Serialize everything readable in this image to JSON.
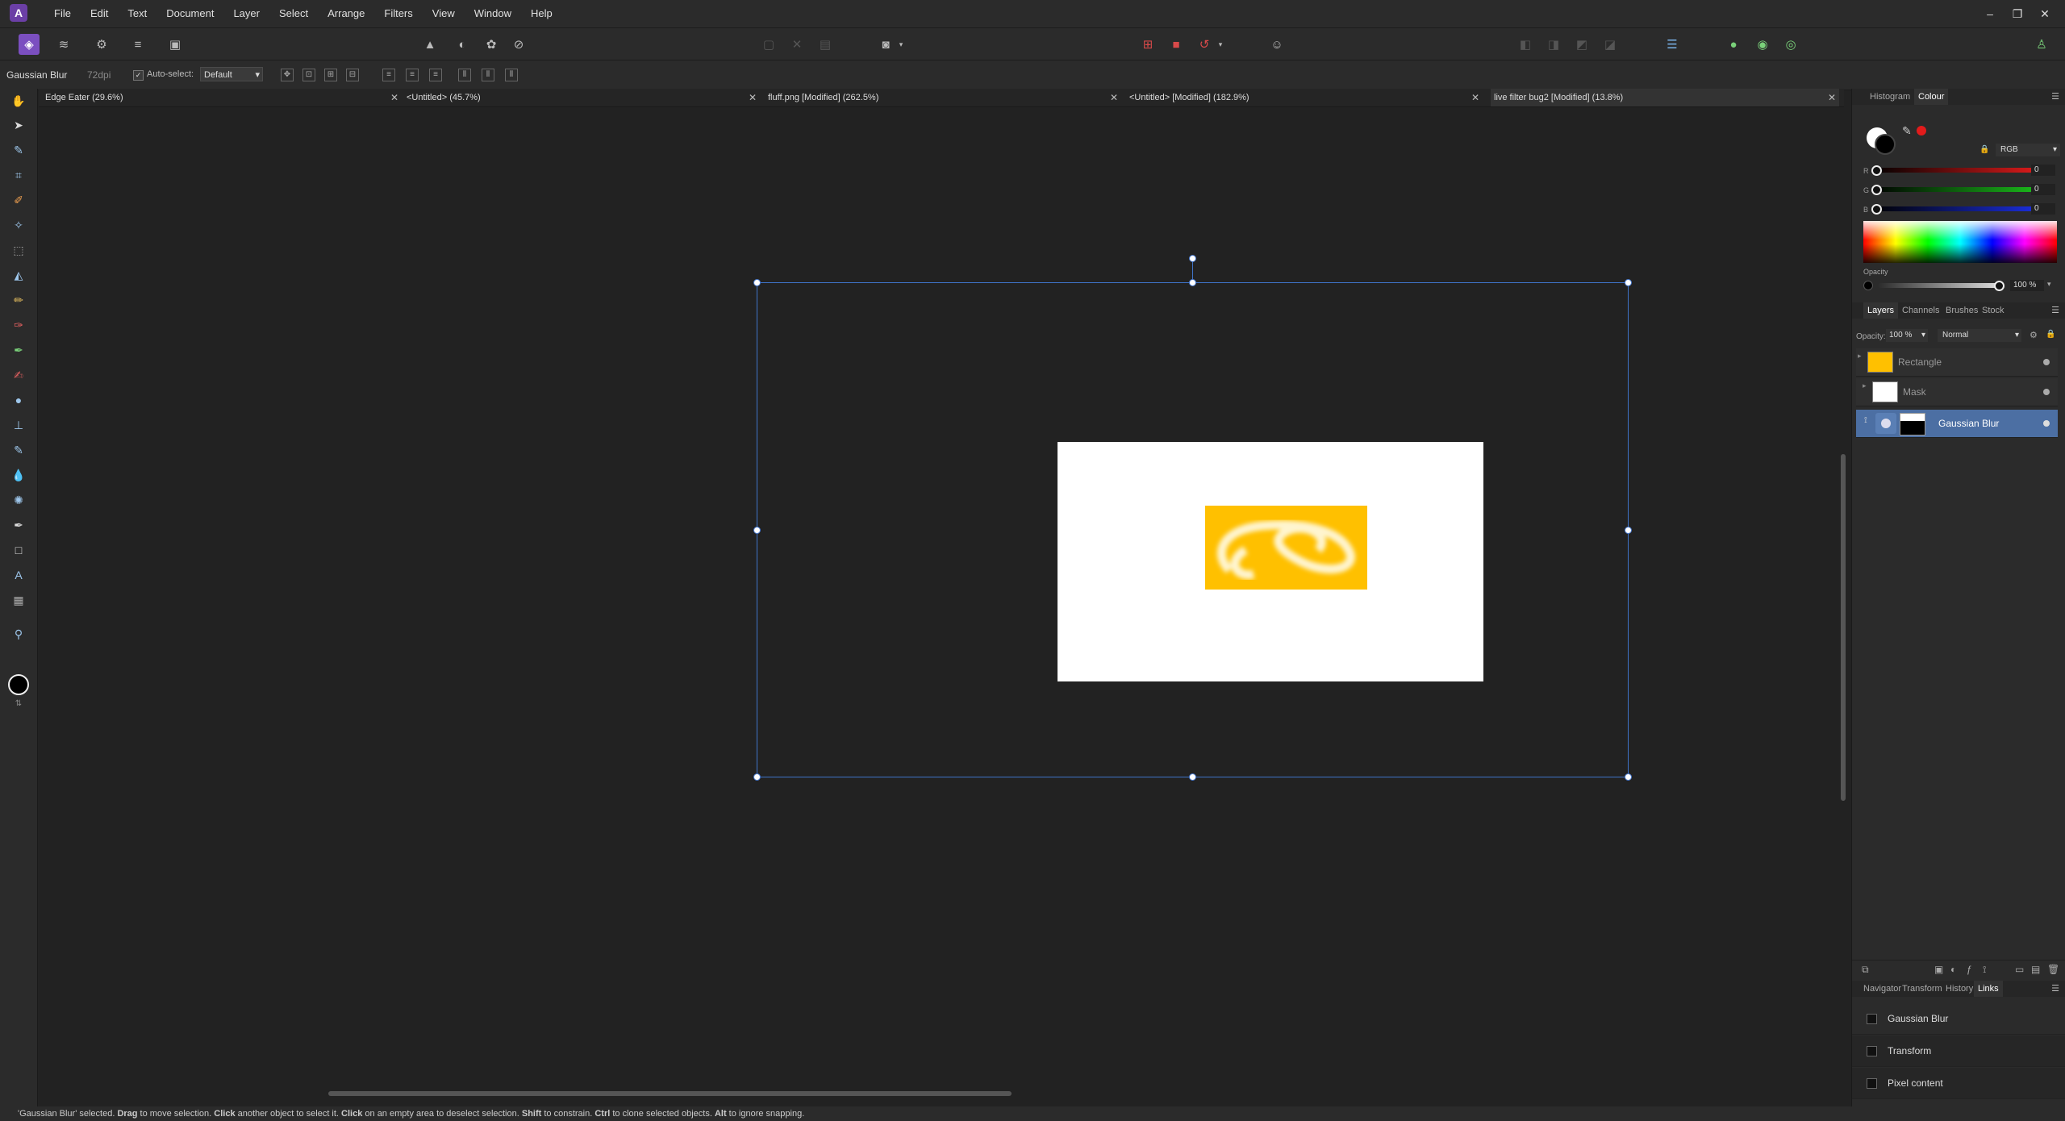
{
  "menu": [
    "File",
    "Edit",
    "Text",
    "Document",
    "Layer",
    "Select",
    "Arrange",
    "Filters",
    "View",
    "Window",
    "Help"
  ],
  "window_controls": {
    "minimize": "–",
    "restore": "❐",
    "close": "✕"
  },
  "context": {
    "selection_name": "Gaussian Blur",
    "dpi": "72dpi",
    "auto_select_label": "Auto-select:",
    "auto_select_value": "Default"
  },
  "tabs": [
    {
      "label": "Edge Eater (29.6%)"
    },
    {
      "label": "<Untitled> (45.7%)"
    },
    {
      "label": "fluff.png [Modified] (262.5%)"
    },
    {
      "label": "<Untitled> [Modified] (182.9%)"
    },
    {
      "label": "live filter bug2 [Modified] (13.8%)"
    }
  ],
  "colour_panel": {
    "tabs": [
      "Histogram",
      "Colour"
    ],
    "active_tab": "Colour",
    "model": "RGB",
    "channels": [
      {
        "label": "R",
        "value": "0",
        "color": "#e21b1b"
      },
      {
        "label": "G",
        "value": "0",
        "color": "#1bbf1b"
      },
      {
        "label": "B",
        "value": "0",
        "color": "#1b2fe2"
      }
    ],
    "opacity_label": "Opacity",
    "opacity_value": "100 %"
  },
  "layers_panel": {
    "tabs": [
      "Layers",
      "Channels",
      "Brushes",
      "Stock"
    ],
    "active_tab": "Layers",
    "opacity_label": "Opacity:",
    "opacity_value": "100 %",
    "blend_mode": "Normal",
    "layers": [
      {
        "name": "Rectangle",
        "selected": false
      },
      {
        "name": "Mask",
        "selected": false
      },
      {
        "name": "Gaussian Blur",
        "selected": true
      }
    ]
  },
  "links_panel": {
    "tabs": [
      "Navigator",
      "Transform",
      "History",
      "Links"
    ],
    "active_tab": "Links",
    "items": [
      "Gaussian Blur",
      "Transform",
      "Pixel content"
    ]
  },
  "status": {
    "parts": [
      {
        "t": "'Gaussian Blur' selected. ",
        "b": false
      },
      {
        "t": "Drag",
        "b": true
      },
      {
        "t": " to move selection. ",
        "b": false
      },
      {
        "t": "Click",
        "b": true
      },
      {
        "t": " another object to select it. ",
        "b": false
      },
      {
        "t": "Click",
        "b": true
      },
      {
        "t": " on an empty area to deselect selection. ",
        "b": false
      },
      {
        "t": "Shift",
        "b": true
      },
      {
        "t": " to constrain. ",
        "b": false
      },
      {
        "t": "Ctrl",
        "b": true
      },
      {
        "t": " to clone selected objects. ",
        "b": false
      },
      {
        "t": "Alt",
        "b": true
      },
      {
        "t": " to ignore snapping.",
        "b": false
      }
    ]
  },
  "colors": {
    "accent": "#4c6fa3",
    "selection": "#3f74c9",
    "artwork_yellow": "#ffc000"
  }
}
